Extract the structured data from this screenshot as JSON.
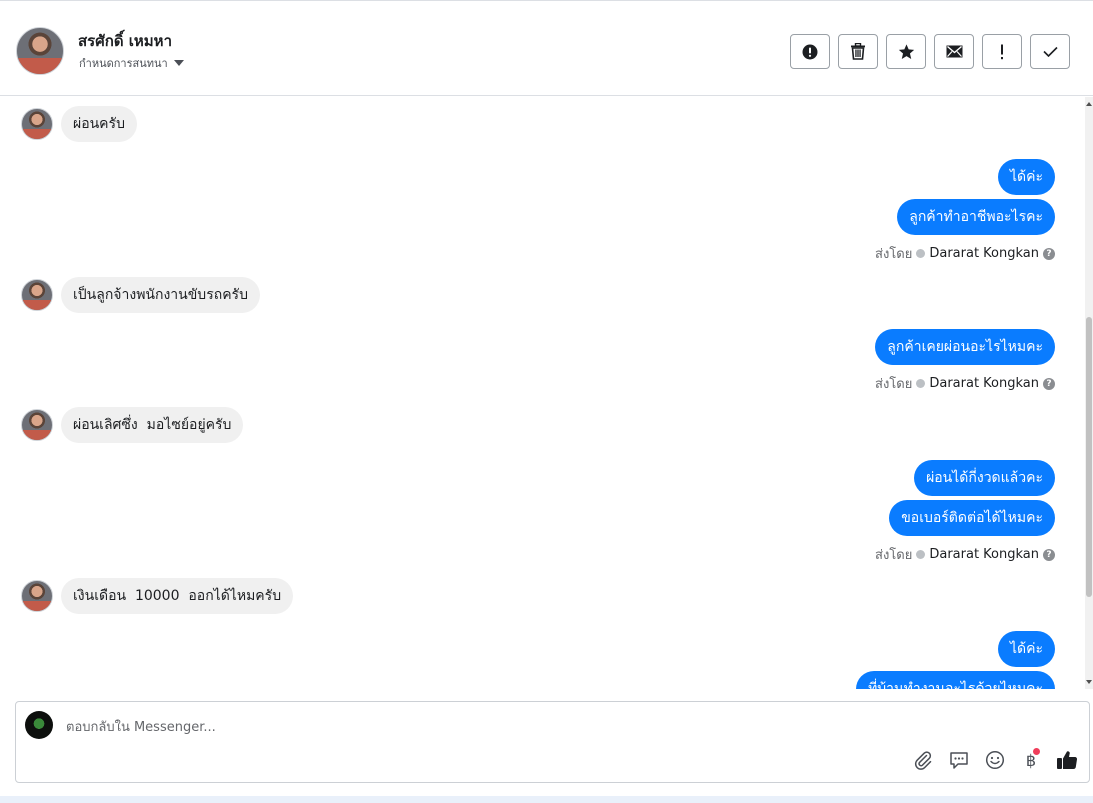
{
  "header": {
    "contact_name": "สรศักดิ์ เหมหา",
    "assign_label": "กำหนดการสนทนา",
    "toolbar": [
      {
        "name": "alert-button",
        "icon": "exclamation-circle-icon"
      },
      {
        "name": "delete-button",
        "icon": "trash-icon"
      },
      {
        "name": "star-button",
        "icon": "star-icon"
      },
      {
        "name": "mark-unread-button",
        "icon": "envelope-icon"
      },
      {
        "name": "follow-up-button",
        "icon": "exclamation-icon"
      },
      {
        "name": "done-button",
        "icon": "check-icon"
      }
    ]
  },
  "messages": {
    "m1": "ผ่อนครับ",
    "m2": "ได้ค่ะ",
    "m3": "ลูกค้าทำอาชีพอะไรคะ",
    "m4": "เป็นลูกจ้างพนักงานขับรถครับ",
    "m5": "ลูกค้าเคยผ่อนอะไรไหมคะ",
    "m6": "ผ่อนเลิศซึ่ง  มอไซย์อยู่ครับ",
    "m7": "ผ่อนได้กี่งวดแล้วคะ",
    "m8": "ขอเบอร์ติดต่อได้ไหมคะ",
    "m9": "เงินเดือน  10000  ออกได้ไหมครับ",
    "m10": "ได้ค่ะ",
    "m11": "ที่บ้านทำงานอะไรด้วยไหมคะ"
  },
  "sent_by": {
    "label": "ส่งโดย",
    "agent": "Dararat Kongkan"
  },
  "composer": {
    "placeholder": "ตอบกลับใน Messenger...",
    "tools": [
      "paperclip-icon",
      "chat-bubble-icon",
      "smile-icon",
      "baht-icon",
      "thumbs-up-icon"
    ],
    "baht_symbol": "฿"
  },
  "colors": {
    "outgoing_bubble": "#0a7cff",
    "incoming_bubble": "#f0f0f0",
    "notification_dot": "#f03d5a"
  }
}
